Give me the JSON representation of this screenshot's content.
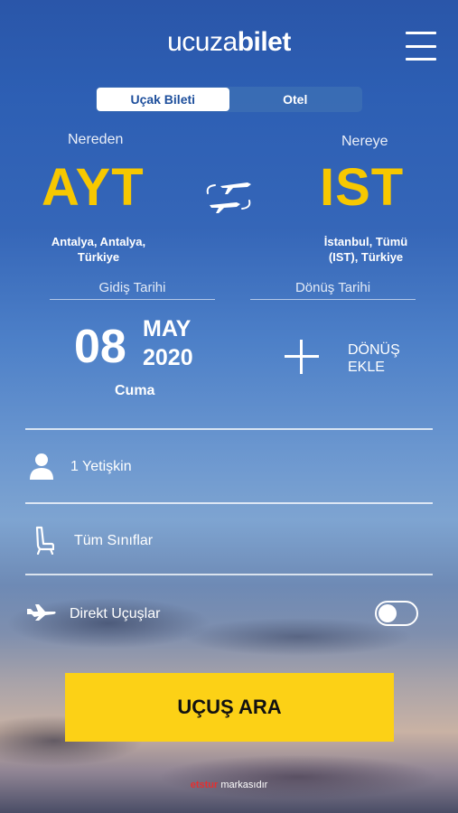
{
  "header": {
    "logo_part1": "ucuza",
    "logo_part2": "bilet",
    "menu_icon": "hamburger-menu-icon"
  },
  "tabs": [
    {
      "label": "Uçak Bileti",
      "active": true
    },
    {
      "label": "Otel",
      "active": false
    }
  ],
  "origin": {
    "label": "Nereden",
    "code": "AYT",
    "city_line1": "Antalya, Antalya,",
    "city_line2": "Türkiye"
  },
  "destination": {
    "label": "Nereye",
    "code": "IST",
    "city_line1": "İstanbul, Tümü",
    "city_line2": "(IST), Türkiye"
  },
  "swap_icon": "swap-planes-icon",
  "departure": {
    "label": "Gidiş Tarihi",
    "day": "08",
    "month": "MAY",
    "year": "2020",
    "weekday": "Cuma"
  },
  "return": {
    "label": "Dönüş Tarihi",
    "add_line1": "DÖNÜŞ",
    "add_line2": "EKLE",
    "icon": "plus-icon"
  },
  "passengers": {
    "label": "1 Yetişkin",
    "icon": "person-icon"
  },
  "cabin_class": {
    "label": "Tüm Sınıflar",
    "icon": "seat-icon"
  },
  "direct_flights": {
    "label": "Direkt Uçuşlar",
    "icon": "plane-icon",
    "enabled": false
  },
  "search_button": {
    "label": "UÇUŞ ARA"
  },
  "footer": {
    "brand": "etstur",
    "suffix": "markasıdır"
  },
  "colors": {
    "accent_yellow": "#fcd116",
    "code_yellow": "#f7c800",
    "tab_blue": "#1e4f9c"
  }
}
